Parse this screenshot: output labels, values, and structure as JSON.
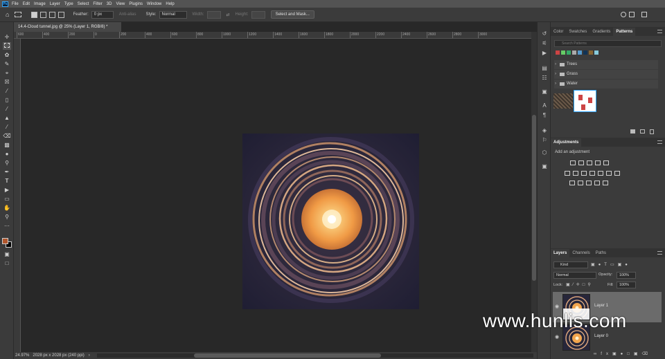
{
  "menubar": {
    "logo": "Ps",
    "items": [
      "File",
      "Edit",
      "Image",
      "Layer",
      "Type",
      "Select",
      "Filter",
      "3D",
      "View",
      "Plugins",
      "Window",
      "Help"
    ]
  },
  "options": {
    "feather_label": "Feather:",
    "feather_value": "0 px",
    "antialias": "Anti-alias",
    "style_label": "Style:",
    "style_value": "Normal",
    "width_label": "Width:",
    "height_label": "Height:",
    "select_mask": "Select and Mask..."
  },
  "document": {
    "tab_title": "14.4-Cloud tunnel.jpg @ 25% (Layer 1, RGB/8) *",
    "ruler_ticks": [
      "600",
      "400",
      "200",
      "0",
      "200",
      "400",
      "600",
      "800",
      "1000",
      "1200",
      "1400",
      "1600",
      "1800",
      "2000",
      "2200",
      "2400",
      "2600",
      "2800",
      "3000"
    ]
  },
  "status": {
    "zoom": "24.97%",
    "info": "2028 px x 2028 px (240 ppi)"
  },
  "panels": {
    "top_tabs": [
      "Color",
      "Swatches",
      "Gradients",
      "Patterns"
    ],
    "active_top_tab": "Patterns",
    "search_placeholder": "Search Patterns",
    "folders": [
      "Trees",
      "Grass",
      "Water"
    ],
    "adjustments_title": "Adjustments",
    "add_adjustment": "Add an adjustment",
    "layer_tabs": [
      "Layers",
      "Channels",
      "Paths"
    ],
    "kind": "Kind",
    "blend_mode": "Normal",
    "opacity_label": "Opacity:",
    "opacity_value": "100%",
    "lock_label": "Lock:",
    "fill_label": "Fill:",
    "fill_value": "100%",
    "layers": [
      "Layer 1",
      "Layer 0"
    ]
  },
  "watermark": "www.hunlis.com",
  "colors": {
    "accent": "#31a8ff",
    "foreground": "#b1562c",
    "background": "#000000",
    "tunnel_glow": "#f5a54a"
  }
}
